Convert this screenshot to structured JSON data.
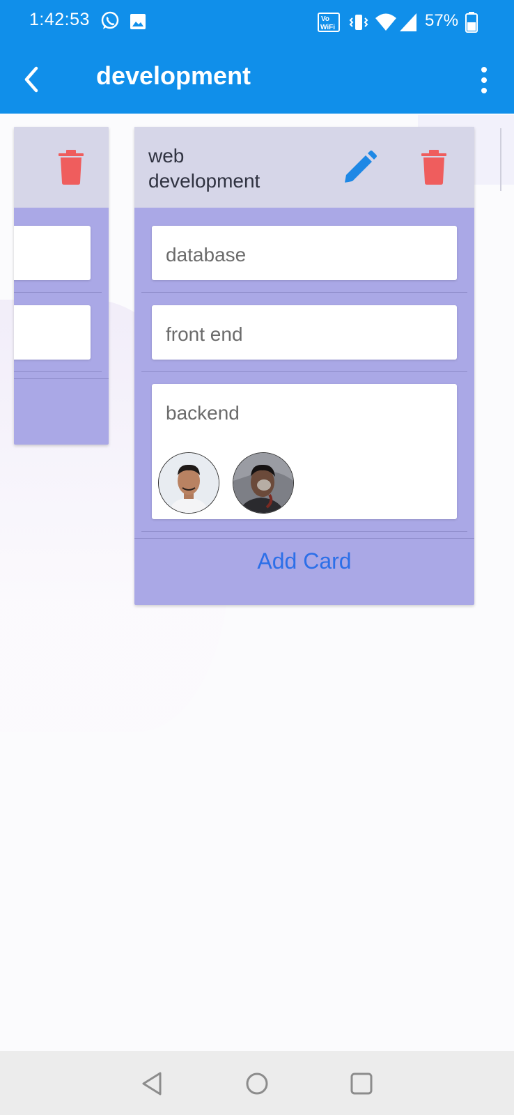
{
  "status_bar": {
    "time": "1:42:53",
    "network_badge": "Vo¹ WiFi",
    "battery": "57%",
    "icons": [
      "whatsapp-icon",
      "image-icon",
      "volte-wifi-icon",
      "vibrate-icon",
      "wifi-icon",
      "signal-icon",
      "battery-icon"
    ]
  },
  "app_bar": {
    "title": "development",
    "back_icon": "back-arrow-icon",
    "menu_icon": "more-vert-icon"
  },
  "colors": {
    "primary": "#108fea",
    "column_bg": "#aaa8e6",
    "header_bg": "#d6d6e8",
    "delete": "#ef5d5d",
    "edit": "#1e88e5",
    "link": "#2c6fe8"
  },
  "columns": [
    {
      "title": "",
      "cards": [
        "",
        ""
      ]
    },
    {
      "title_line1": "web",
      "title_line2": "development",
      "cards": [
        {
          "text": "database"
        },
        {
          "text": "front end"
        },
        {
          "text": "backend",
          "avatars": [
            "member-avatar-1",
            "member-avatar-2"
          ]
        }
      ],
      "add_card_label": "Add Card"
    }
  ]
}
